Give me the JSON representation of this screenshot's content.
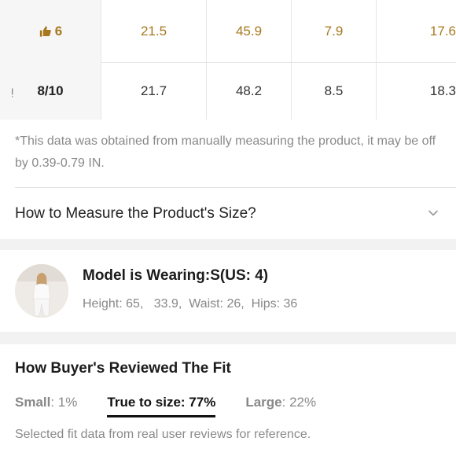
{
  "size_table": {
    "rows": [
      {
        "size": "6",
        "recommended": true,
        "values": [
          "21.5",
          "45.9",
          "7.9",
          "17.6"
        ]
      },
      {
        "size": "8/10",
        "recommended": false,
        "left_edge": "ᴉ",
        "values": [
          "21.7",
          "48.2",
          "8.5",
          "18.3"
        ]
      }
    ],
    "recommended_color": "#a8781f"
  },
  "note": "*This data was obtained from manually measuring the product, it may be off by 0.39-0.79 IN.",
  "measure": {
    "label": "How to Measure the Product's Size?",
    "icon": "chevron-down-icon"
  },
  "model": {
    "title": "Model is Wearing:S(US: 4)",
    "meta": "Height: 65,   33.9,  Waist: 26,  Hips: 36"
  },
  "fit": {
    "title": "How Buyer's Reviewed The Fit",
    "options": [
      {
        "key": "Small",
        "value": ": 1%"
      },
      {
        "key": "True to size",
        "value": ": 77%"
      },
      {
        "key": "Large",
        "value": ": 22%"
      }
    ],
    "active_index": 1,
    "note": "Selected fit data from real user reviews for reference."
  }
}
